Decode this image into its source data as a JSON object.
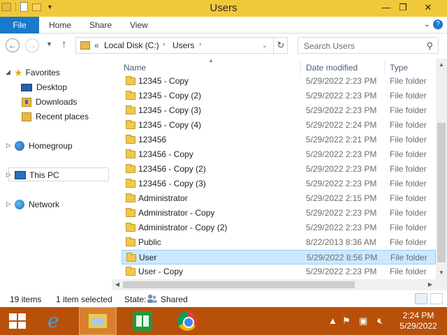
{
  "window": {
    "title": "Users"
  },
  "ribbon": {
    "file": "File",
    "tabs": [
      "Home",
      "Share",
      "View"
    ],
    "help": "?"
  },
  "address": {
    "chevrons": "«",
    "segments": [
      "Local Disk (C:)",
      "Users"
    ]
  },
  "search": {
    "placeholder": "Search Users"
  },
  "navpane": {
    "favorites": "Favorites",
    "desktop": "Desktop",
    "downloads": "Downloads",
    "recent": "Recent places",
    "homegroup": "Homegroup",
    "thispc": "This PC",
    "network": "Network"
  },
  "columns": {
    "name": "Name",
    "date": "Date modified",
    "type": "Type"
  },
  "files": [
    {
      "name": "12345 - Copy",
      "date": "5/29/2022 2:23 PM",
      "type": "File folder"
    },
    {
      "name": "12345 - Copy (2)",
      "date": "5/29/2022 2:23 PM",
      "type": "File folder"
    },
    {
      "name": "12345 - Copy (3)",
      "date": "5/29/2022 2:23 PM",
      "type": "File folder"
    },
    {
      "name": "12345 - Copy (4)",
      "date": "5/29/2022 2:24 PM",
      "type": "File folder"
    },
    {
      "name": "123456",
      "date": "5/29/2022 2:21 PM",
      "type": "File folder"
    },
    {
      "name": "123456 - Copy",
      "date": "5/29/2022 2:23 PM",
      "type": "File folder"
    },
    {
      "name": "123456 - Copy (2)",
      "date": "5/29/2022 2:23 PM",
      "type": "File folder"
    },
    {
      "name": "123456 - Copy (3)",
      "date": "5/29/2022 2:23 PM",
      "type": "File folder"
    },
    {
      "name": "Administrator",
      "date": "5/29/2022 2:15 PM",
      "type": "File folder"
    },
    {
      "name": "Administrator - Copy",
      "date": "5/29/2022 2:23 PM",
      "type": "File folder"
    },
    {
      "name": "Administrator - Copy (2)",
      "date": "5/29/2022 2:23 PM",
      "type": "File folder"
    },
    {
      "name": "Public",
      "date": "8/22/2013 8:36 AM",
      "type": "File folder"
    },
    {
      "name": "User",
      "date": "5/29/2022 8:56 PM",
      "type": "File folder"
    },
    {
      "name": "User - Copy",
      "date": "5/29/2022 2:23 PM",
      "type": "File folder"
    }
  ],
  "selected_file": "User",
  "status": {
    "count": "19 items",
    "selection": "1 item selected",
    "state_label": "State:",
    "state_value": "Shared"
  },
  "clock": {
    "time": "2:24 PM",
    "date": "5/29/2022"
  },
  "colors": {
    "title_bar": "#f0c93a",
    "file_tab": "#1979ca",
    "taskbar": "#b8500a",
    "selection": "#cce8ff"
  }
}
